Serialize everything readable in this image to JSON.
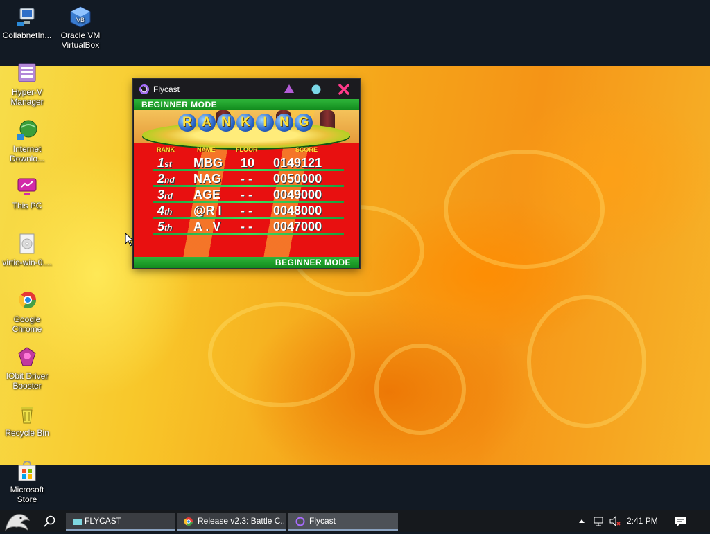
{
  "desktop": {
    "icons": [
      {
        "label": "CollabnetIn..."
      },
      {
        "label": "Oracle VM VirtualBox"
      },
      {
        "label": "Hyper-V Manager"
      },
      {
        "label": "Internet Downlo..."
      },
      {
        "label": "This PC"
      },
      {
        "label": "virtio-win-0...."
      },
      {
        "label": "Google Chrome"
      },
      {
        "label": "IObit Driver Booster"
      },
      {
        "label": "Recycle Bin"
      },
      {
        "label": "Microsoft Store"
      }
    ]
  },
  "window": {
    "title": "Flycast",
    "buttons": {
      "triangle": "triangle-icon",
      "circle": "circle-icon",
      "close": "close-icon"
    },
    "colors": {
      "triangle": "#b35cd6",
      "circle": "#7ad7e6",
      "close": "#ff3a8a"
    }
  },
  "game": {
    "mode_top": "BEGINNER  MODE",
    "mode_bottom": "BEGINNER  MODE",
    "title_letters": [
      "R",
      "A",
      "N",
      "K",
      "I",
      "N",
      "G"
    ],
    "headers": {
      "rank": "RANK",
      "name": "NAME",
      "floor": "FLOOR",
      "score": "SCORE"
    },
    "rows": [
      {
        "rank": "1",
        "suffix": "st",
        "name": "MBG",
        "floor": "10",
        "score": "0149121"
      },
      {
        "rank": "2",
        "suffix": "nd",
        "name": "NAG",
        "floor": "- -",
        "score": "0050000"
      },
      {
        "rank": "3",
        "suffix": "rd",
        "name": "AGE",
        "floor": "- -",
        "score": "0049000"
      },
      {
        "rank": "4",
        "suffix": "th",
        "name": "@R I",
        "floor": "- -",
        "score": "0048000"
      },
      {
        "rank": "5",
        "suffix": "th",
        "name": "A . V",
        "floor": "- -",
        "score": "0047000"
      }
    ]
  },
  "taskbar": {
    "buttons": [
      {
        "label": "FLYCAST"
      },
      {
        "label": "Release v2.3: Battle C..."
      },
      {
        "label": "Flycast"
      }
    ],
    "clock": "2:41 PM"
  }
}
